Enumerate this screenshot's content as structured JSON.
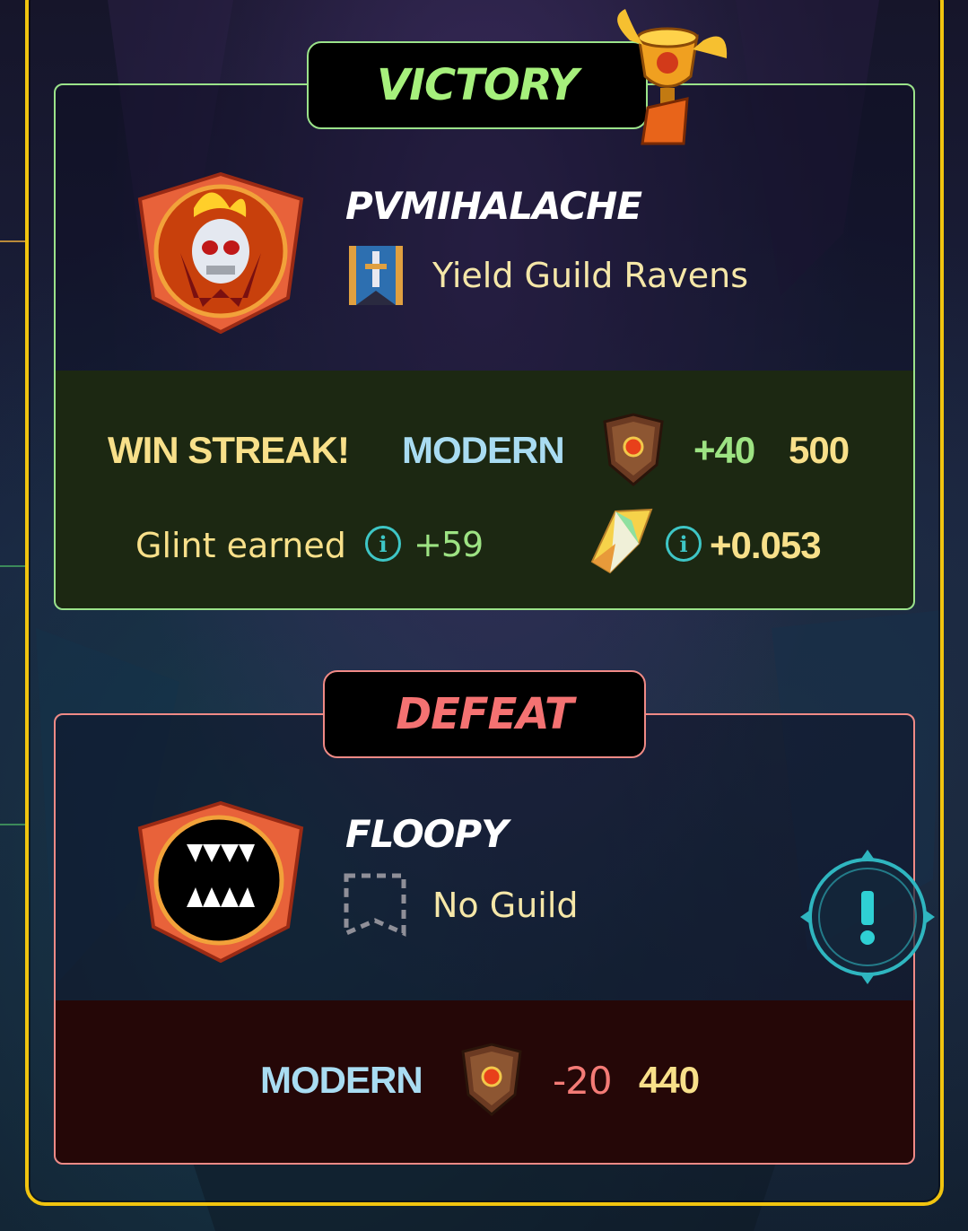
{
  "victory": {
    "banner": "VICTORY",
    "player": {
      "name": "PVMIHALACHE",
      "avatar_icon": "flaming-skull-icon"
    },
    "guild": {
      "name": "Yield Guild Ravens",
      "icon": "sword-banner-icon"
    },
    "streak_label": "WIN STREAK!",
    "format": "MODERN",
    "rating_change": "+40",
    "rating": "500",
    "glint_label": "Glint earned",
    "glint_value": "+59",
    "shard_value": "+0.053"
  },
  "defeat": {
    "banner": "DEFEAT",
    "player": {
      "name": "FLOOPY",
      "avatar_icon": "fanged-mouth-icon"
    },
    "guild": {
      "name": "No Guild",
      "icon": "empty-banner-icon"
    },
    "format": "MODERN",
    "rating_change": "-20",
    "rating": "440"
  },
  "colors": {
    "frame": "#f1c40f",
    "victory_accent": "#9be38a",
    "defeat_accent": "#f08a86",
    "modern_label": "#a9dcf2",
    "info_icon": "#3ec6c6"
  }
}
